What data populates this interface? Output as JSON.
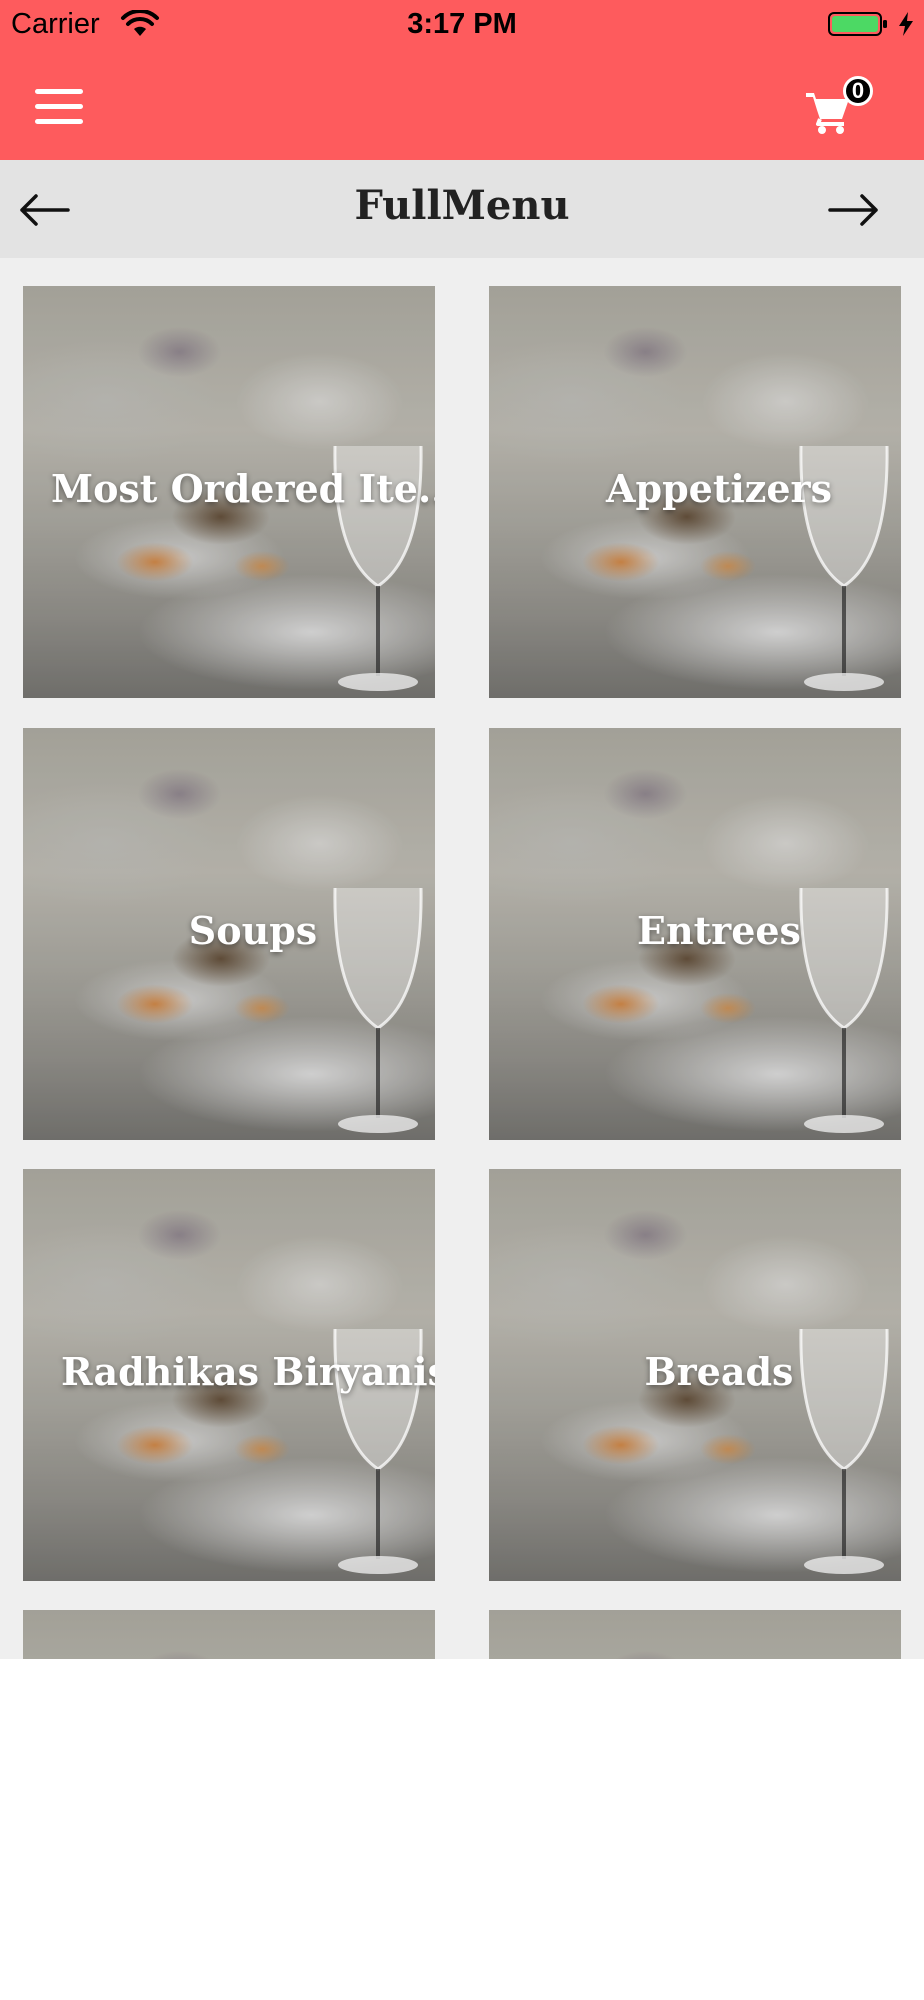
{
  "status_bar": {
    "carrier": "Carrier",
    "time": "3:17 PM"
  },
  "nav_bar": {
    "cart_count": "0",
    "accent_color": "#fe5b5d"
  },
  "sub_header": {
    "title": "FullMenu"
  },
  "categories": [
    {
      "label": "Most Ordered Ite..."
    },
    {
      "label": "Appetizers"
    },
    {
      "label": "Soups"
    },
    {
      "label": "Entrees"
    },
    {
      "label": "Radhikas Biryanis"
    },
    {
      "label": "Breads"
    },
    {
      "label": ""
    },
    {
      "label": ""
    }
  ]
}
